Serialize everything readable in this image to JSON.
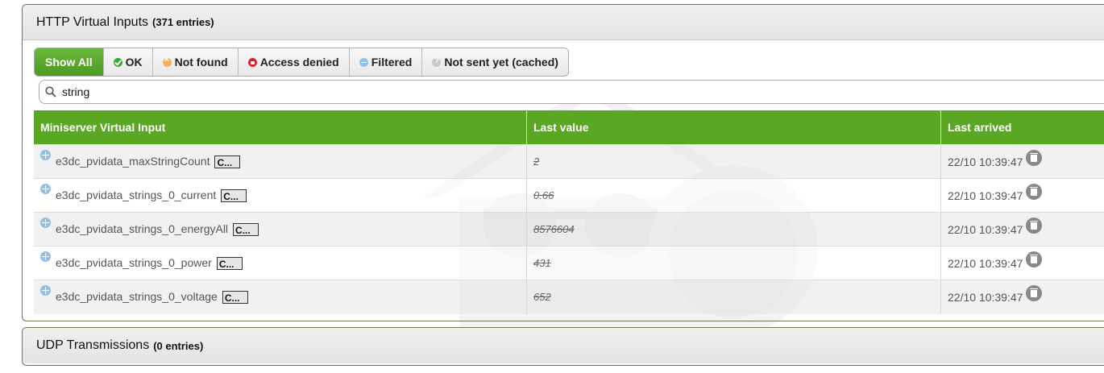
{
  "http_panel": {
    "title": "HTTP Virtual Inputs",
    "count": "(371 entries)"
  },
  "filters": [
    {
      "label": "Show All",
      "icon": "none",
      "active": true
    },
    {
      "label": "OK",
      "icon": "check-circle-icon"
    },
    {
      "label": "Not found",
      "icon": "not-found-icon"
    },
    {
      "label": "Access denied",
      "icon": "lock-icon"
    },
    {
      "label": "Filtered",
      "icon": "filter-icon"
    },
    {
      "label": "Not sent yet (cached)",
      "icon": "question-icon"
    }
  ],
  "search": {
    "value": "string"
  },
  "table": {
    "headers": [
      "Miniserver Virtual Input",
      "Last value",
      "Last arrived"
    ],
    "rows": [
      {
        "name": "e3dc_pvidata_maxStringCount",
        "button": "C...",
        "value": "2",
        "time": "22/10 10:39:47"
      },
      {
        "name": "e3dc_pvidata_strings_0_current",
        "button": "C...",
        "value": "0.66",
        "time": "22/10 10:39:47"
      },
      {
        "name": "e3dc_pvidata_strings_0_energyAll",
        "button": "C...",
        "value": "8576604",
        "time": "22/10 10:39:47"
      },
      {
        "name": "e3dc_pvidata_strings_0_power",
        "button": "C...",
        "value": "431",
        "time": "22/10 10:39:47"
      },
      {
        "name": "e3dc_pvidata_strings_0_voltage",
        "button": "C...",
        "value": "652",
        "time": "22/10 10:39:47"
      }
    ]
  },
  "udp_panel": {
    "title": "UDP Transmissions",
    "count": "(0 entries)"
  },
  "colors": {
    "accent": "#5aa724",
    "filtered": "#8fc1ea"
  }
}
